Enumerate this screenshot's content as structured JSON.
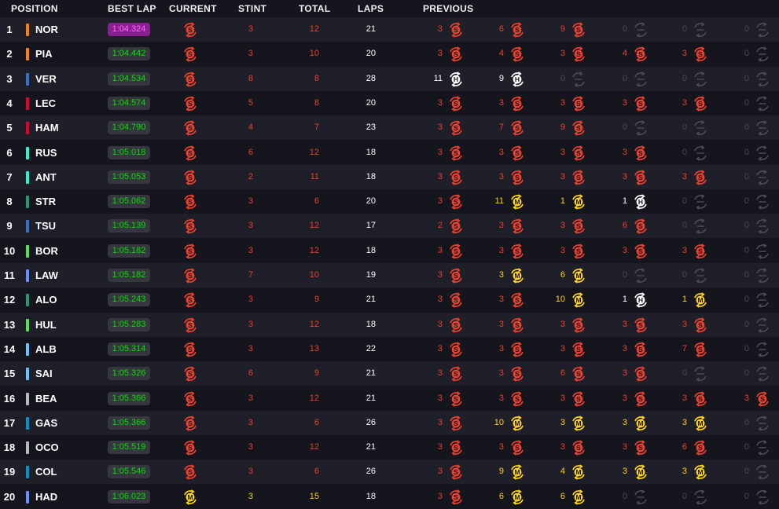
{
  "headers": {
    "position": "POSITION",
    "best_lap": "BEST LAP",
    "current": "CURRENT",
    "stint": "STINT",
    "total": "TOTAL",
    "laps": "LAPS",
    "previous": "PREVIOUS"
  },
  "colors": {
    "soft": "#e8412e",
    "medium": "#ffd21e",
    "hard": "#ffffff",
    "none": "#4a4a52",
    "fastest_bg": "#8a1f8f",
    "lap_green": "#00e000"
  },
  "rows": [
    {
      "pos": "1",
      "driver": "NOR",
      "team_color": "#ff8000",
      "best": "1:04.324",
      "fastest": true,
      "current": "S",
      "stint": "3",
      "total": "12",
      "laps": "21",
      "prev": [
        [
          "3",
          "S"
        ],
        [
          "6",
          "S"
        ],
        [
          "9",
          "S"
        ],
        [
          "0",
          "-"
        ],
        [
          "0",
          "-"
        ],
        [
          "0",
          "-"
        ]
      ]
    },
    {
      "pos": "2",
      "driver": "PIA",
      "team_color": "#ff8000",
      "best": "1:04.442",
      "current": "S",
      "stint": "3",
      "total": "10",
      "laps": "20",
      "prev": [
        [
          "3",
          "S"
        ],
        [
          "4",
          "S"
        ],
        [
          "3",
          "S"
        ],
        [
          "4",
          "S"
        ],
        [
          "3",
          "S"
        ],
        [
          "0",
          "-"
        ]
      ]
    },
    {
      "pos": "3",
      "driver": "VER",
      "team_color": "#3671c6",
      "best": "1:04.534",
      "current": "S",
      "stint": "8",
      "total": "8",
      "laps": "28",
      "prev": [
        [
          "11",
          "H"
        ],
        [
          "9",
          "H"
        ],
        [
          "0",
          "-"
        ],
        [
          "0",
          "-"
        ],
        [
          "0",
          "-"
        ],
        [
          "0",
          "-"
        ]
      ]
    },
    {
      "pos": "4",
      "driver": "LEC",
      "team_color": "#e8002d",
      "best": "1:04.574",
      "current": "S",
      "stint": "5",
      "total": "8",
      "laps": "20",
      "prev": [
        [
          "3",
          "S"
        ],
        [
          "3",
          "S"
        ],
        [
          "3",
          "S"
        ],
        [
          "3",
          "S"
        ],
        [
          "3",
          "S"
        ],
        [
          "0",
          "-"
        ]
      ]
    },
    {
      "pos": "5",
      "driver": "HAM",
      "team_color": "#e8002d",
      "best": "1:04.790",
      "current": "S",
      "stint": "4",
      "total": "7",
      "laps": "23",
      "prev": [
        [
          "3",
          "S"
        ],
        [
          "7",
          "S"
        ],
        [
          "9",
          "S"
        ],
        [
          "0",
          "-"
        ],
        [
          "0",
          "-"
        ],
        [
          "0",
          "-"
        ]
      ]
    },
    {
      "pos": "6",
      "driver": "RUS",
      "team_color": "#27f4d2",
      "best": "1:05.018",
      "current": "S",
      "stint": "6",
      "total": "12",
      "laps": "18",
      "prev": [
        [
          "3",
          "S"
        ],
        [
          "3",
          "S"
        ],
        [
          "3",
          "S"
        ],
        [
          "3",
          "S"
        ],
        [
          "0",
          "-"
        ],
        [
          "0",
          "-"
        ]
      ]
    },
    {
      "pos": "7",
      "driver": "ANT",
      "team_color": "#27f4d2",
      "best": "1:05.053",
      "current": "S",
      "stint": "2",
      "total": "11",
      "laps": "18",
      "prev": [
        [
          "3",
          "S"
        ],
        [
          "3",
          "S"
        ],
        [
          "3",
          "S"
        ],
        [
          "3",
          "S"
        ],
        [
          "3",
          "S"
        ],
        [
          "0",
          "-"
        ]
      ]
    },
    {
      "pos": "8",
      "driver": "STR",
      "team_color": "#229971",
      "best": "1:05.062",
      "current": "S",
      "stint": "3",
      "total": "6",
      "laps": "20",
      "prev": [
        [
          "3",
          "S"
        ],
        [
          "11",
          "M"
        ],
        [
          "1",
          "M"
        ],
        [
          "1",
          "H"
        ],
        [
          "0",
          "-"
        ],
        [
          "0",
          "-"
        ]
      ]
    },
    {
      "pos": "9",
      "driver": "TSU",
      "team_color": "#3671c6",
      "best": "1:05.139",
      "current": "S",
      "stint": "3",
      "total": "12",
      "laps": "17",
      "prev": [
        [
          "2",
          "S"
        ],
        [
          "3",
          "S"
        ],
        [
          "3",
          "S"
        ],
        [
          "6",
          "S"
        ],
        [
          "0",
          "-"
        ],
        [
          "0",
          "-"
        ]
      ]
    },
    {
      "pos": "10",
      "driver": "BOR",
      "team_color": "#52e252",
      "best": "1:05.182",
      "current": "S",
      "stint": "3",
      "total": "12",
      "laps": "18",
      "prev": [
        [
          "3",
          "S"
        ],
        [
          "3",
          "S"
        ],
        [
          "3",
          "S"
        ],
        [
          "3",
          "S"
        ],
        [
          "3",
          "S"
        ],
        [
          "0",
          "-"
        ]
      ]
    },
    {
      "pos": "11",
      "driver": "LAW",
      "team_color": "#6692ff",
      "best": "1:05.182",
      "current": "S",
      "stint": "7",
      "total": "10",
      "laps": "19",
      "prev": [
        [
          "3",
          "S"
        ],
        [
          "3",
          "M"
        ],
        [
          "6",
          "M"
        ],
        [
          "0",
          "-"
        ],
        [
          "0",
          "-"
        ],
        [
          "0",
          "-"
        ]
      ]
    },
    {
      "pos": "12",
      "driver": "ALO",
      "team_color": "#229971",
      "best": "1:05.243",
      "current": "S",
      "stint": "3",
      "total": "9",
      "laps": "21",
      "prev": [
        [
          "3",
          "S"
        ],
        [
          "3",
          "S"
        ],
        [
          "10",
          "M"
        ],
        [
          "1",
          "H"
        ],
        [
          "1",
          "M"
        ],
        [
          "0",
          "-"
        ]
      ]
    },
    {
      "pos": "13",
      "driver": "HUL",
      "team_color": "#52e252",
      "best": "1:05.283",
      "current": "S",
      "stint": "3",
      "total": "12",
      "laps": "18",
      "prev": [
        [
          "3",
          "S"
        ],
        [
          "3",
          "S"
        ],
        [
          "3",
          "S"
        ],
        [
          "3",
          "S"
        ],
        [
          "3",
          "S"
        ],
        [
          "0",
          "-"
        ]
      ]
    },
    {
      "pos": "14",
      "driver": "ALB",
      "team_color": "#64c4ff",
      "best": "1:05.314",
      "current": "S",
      "stint": "3",
      "total": "13",
      "laps": "22",
      "prev": [
        [
          "3",
          "S"
        ],
        [
          "3",
          "S"
        ],
        [
          "3",
          "S"
        ],
        [
          "3",
          "S"
        ],
        [
          "7",
          "S"
        ],
        [
          "0",
          "-"
        ]
      ]
    },
    {
      "pos": "15",
      "driver": "SAI",
      "team_color": "#64c4ff",
      "best": "1:05.326",
      "current": "S",
      "stint": "6",
      "total": "9",
      "laps": "21",
      "prev": [
        [
          "3",
          "S"
        ],
        [
          "3",
          "S"
        ],
        [
          "6",
          "S"
        ],
        [
          "3",
          "S"
        ],
        [
          "0",
          "-"
        ],
        [
          "0",
          "-"
        ]
      ]
    },
    {
      "pos": "16",
      "driver": "BEA",
      "team_color": "#b6babd",
      "best": "1:05.366",
      "current": "S",
      "stint": "3",
      "total": "12",
      "laps": "21",
      "prev": [
        [
          "3",
          "S"
        ],
        [
          "3",
          "S"
        ],
        [
          "3",
          "S"
        ],
        [
          "3",
          "S"
        ],
        [
          "3",
          "S"
        ],
        [
          "3",
          "S"
        ]
      ]
    },
    {
      "pos": "17",
      "driver": "GAS",
      "team_color": "#0093cc",
      "best": "1:05.366",
      "current": "S",
      "stint": "3",
      "total": "6",
      "laps": "26",
      "prev": [
        [
          "3",
          "S"
        ],
        [
          "10",
          "M"
        ],
        [
          "3",
          "M"
        ],
        [
          "3",
          "M"
        ],
        [
          "3",
          "M"
        ],
        [
          "0",
          "-"
        ]
      ]
    },
    {
      "pos": "18",
      "driver": "OCO",
      "team_color": "#b6babd",
      "best": "1:05.519",
      "current": "S",
      "stint": "3",
      "total": "12",
      "laps": "21",
      "prev": [
        [
          "3",
          "S"
        ],
        [
          "3",
          "S"
        ],
        [
          "3",
          "S"
        ],
        [
          "3",
          "S"
        ],
        [
          "6",
          "S"
        ],
        [
          "0",
          "-"
        ]
      ]
    },
    {
      "pos": "19",
      "driver": "COL",
      "team_color": "#0093cc",
      "best": "1:05.546",
      "current": "S",
      "stint": "3",
      "total": "6",
      "laps": "26",
      "prev": [
        [
          "3",
          "S"
        ],
        [
          "9",
          "M"
        ],
        [
          "4",
          "M"
        ],
        [
          "3",
          "M"
        ],
        [
          "3",
          "M"
        ],
        [
          "0",
          "-"
        ]
      ]
    },
    {
      "pos": "20",
      "driver": "HAD",
      "team_color": "#6692ff",
      "best": "1:06.023",
      "current": "M",
      "stint": "3",
      "total": "15",
      "laps": "18",
      "prev": [
        [
          "3",
          "S"
        ],
        [
          "6",
          "M"
        ],
        [
          "6",
          "M"
        ],
        [
          "0",
          "-"
        ],
        [
          "0",
          "-"
        ],
        [
          "0",
          "-"
        ]
      ]
    }
  ]
}
